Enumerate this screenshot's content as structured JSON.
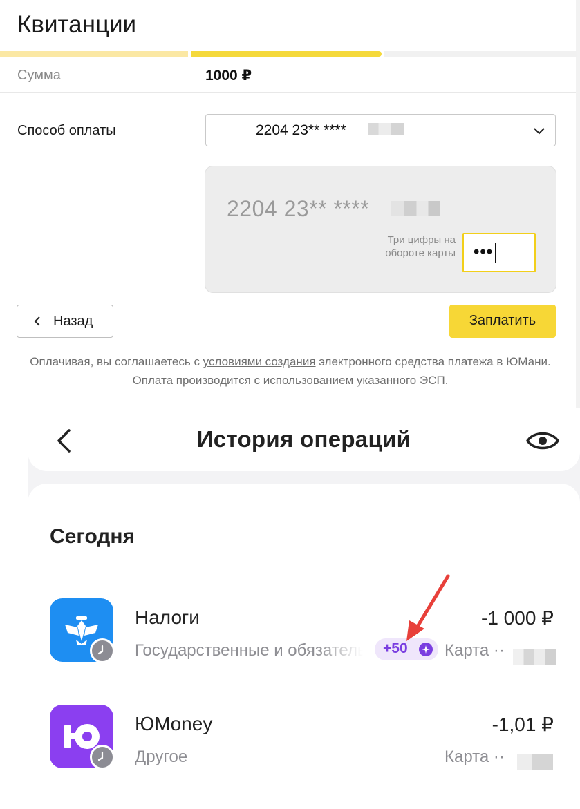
{
  "receipt": {
    "title": "Квитанции",
    "progress_steps": 3,
    "progress_current_step": 2,
    "sum_label": "Сумма",
    "sum_value": "1000 ₽",
    "payment_method_label": "Способ оплаты",
    "selected_card": "2204 23** ****",
    "card_number": "2204 23** ****",
    "cvv_hint": "Три цифры на обороте карты",
    "cvv_value": "•••",
    "back_button": "Назад",
    "pay_button": "Заплатить",
    "terms_before_link": "Оплачивая, вы соглашаетесь с ",
    "terms_link": "условиями создания",
    "terms_after_link": " электронного средства платежа в ЮМани. Оплата производится с использованием указанного ЭСП."
  },
  "history": {
    "title": "История операций",
    "section_today": "Сегодня",
    "operations": [
      {
        "title": "Налоги",
        "subtitle": "Государственные и обязательные платежи",
        "amount": "-1 000 ₽",
        "bonus": "+50",
        "account": "Карта ··",
        "icon": "eagle-emblem-icon",
        "status": "pending"
      },
      {
        "title": "ЮMoney",
        "subtitle": "Другое",
        "amount": "-1,01 ₽",
        "account": "Карта ··",
        "icon": "yumoney-logo-icon",
        "status": "pending"
      }
    ]
  },
  "colors": {
    "accent_yellow": "#f7d736",
    "nalogi_blue": "#1e8ef2",
    "yumoney_purple": "#8b3ff0",
    "bonus_purple": "#7a3ee0",
    "annotation_red": "#e8403a"
  }
}
